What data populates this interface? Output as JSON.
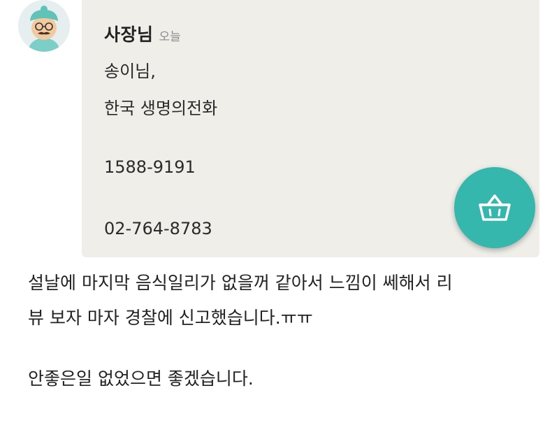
{
  "message": {
    "sender": "사장님",
    "time": "오늘",
    "lines": [
      "송이님,",
      "한국 생명의전화",
      "1588-9191",
      "02-764-8783"
    ]
  },
  "fab": {
    "icon": "shopping-basket-icon",
    "color": "#35b7ad"
  },
  "post": {
    "paragraph1": [
      "설날에 마지막 음식일리가 없을꺼 같아서 느낌이 쎄해서 리",
      "뷰 보자 마자 경찰에 신고했습니다.ㅠㅠ"
    ],
    "paragraph2": "안좋은일 없었으면 좋겠습니다."
  }
}
